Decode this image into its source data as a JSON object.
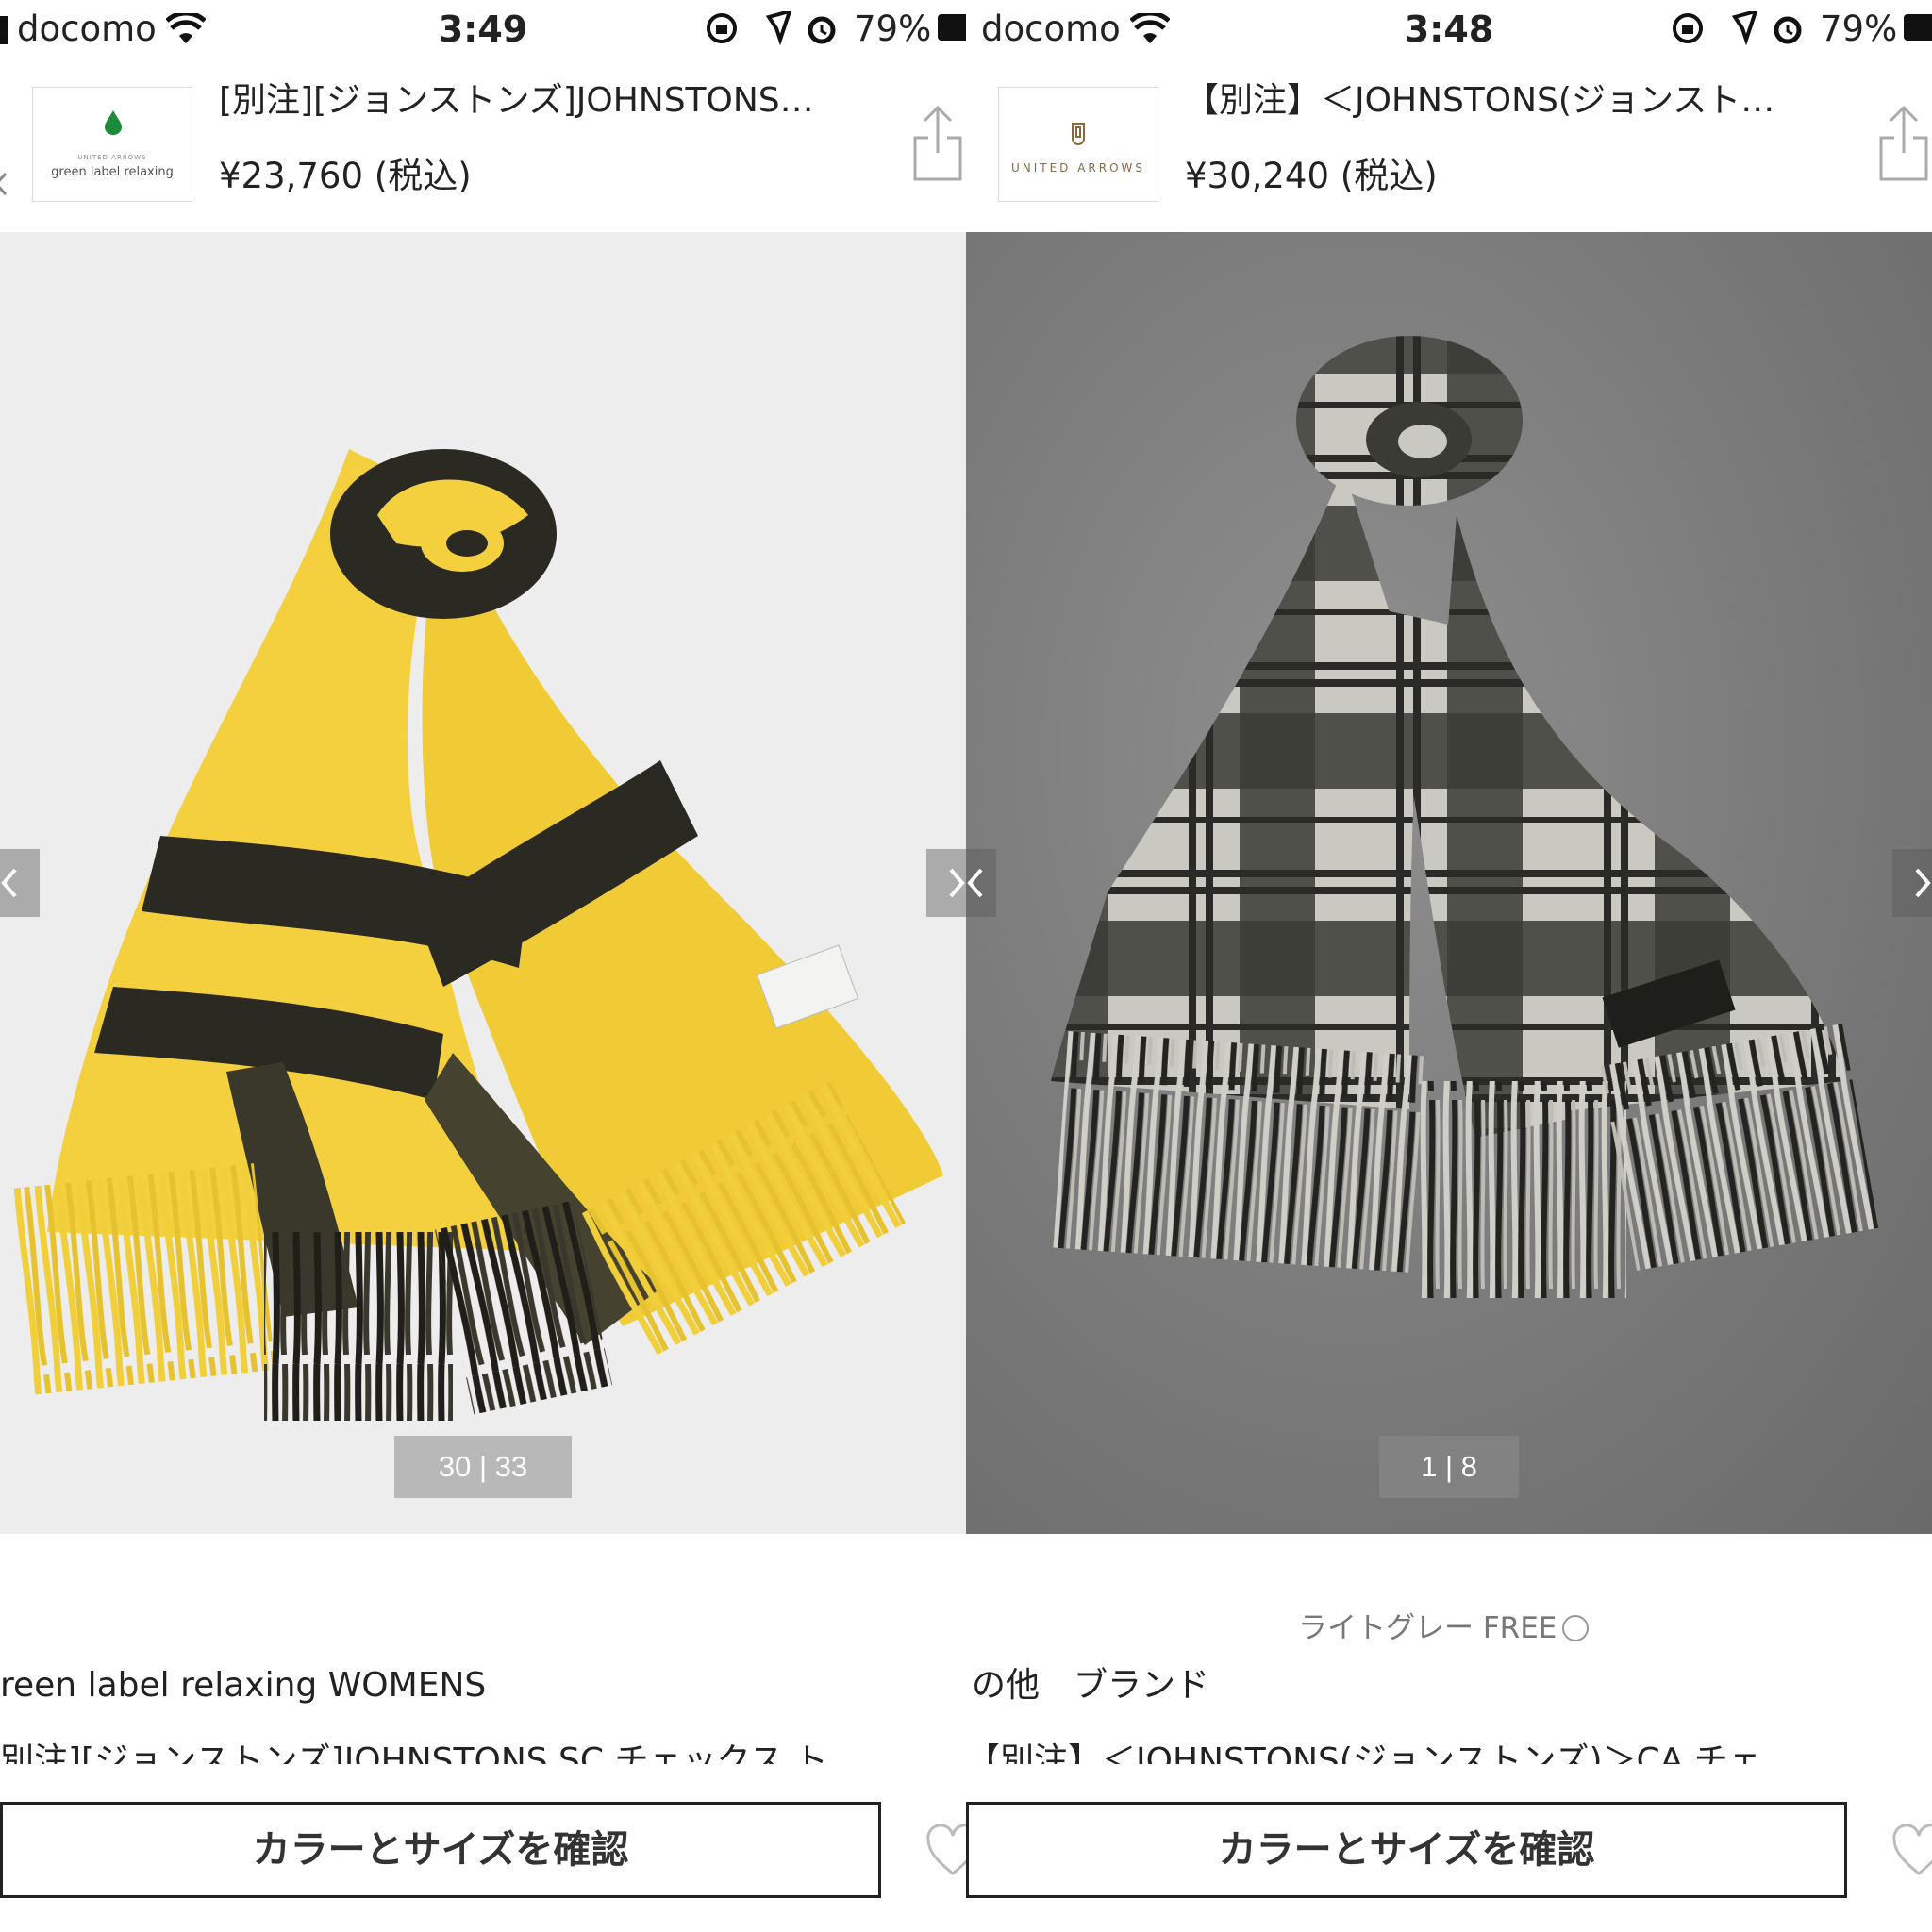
{
  "panels": [
    {
      "status": {
        "carrier": "docomo",
        "time": "3:49",
        "battery": "79%"
      },
      "header": {
        "logo_small": "UNITED ARROWS",
        "logo_text": "green label relaxing",
        "title": "[別注][ジョンストンズ]JOHNSTONS…",
        "price": "¥23,760 (税込)"
      },
      "gallery": {
        "counter": "30 | 33",
        "colors": {
          "background": "#eeedee",
          "scarf_primary": "#f4d03f",
          "scarf_stripe": "#2b2a22"
        }
      },
      "color_size": "",
      "brand": "reen label relaxing WOMENS",
      "description": "別注][ジョンストンズ]JOHNSTONS SC チェックス ト",
      "cta_label": "カラーとサイズを確認"
    },
    {
      "status": {
        "carrier": "docomo",
        "time": "3:48",
        "battery": "79%"
      },
      "header": {
        "logo_text": "UNITED ARROWS",
        "title": "【別注】＜JOHNSTONS(ジョンスト…",
        "price": "¥30,240 (税込)"
      },
      "gallery": {
        "counter": "1 | 8",
        "colors": {
          "background": "#7a7a7a",
          "scarf_primary": "#c9c9c2",
          "scarf_stripe": "#2a2a26"
        }
      },
      "color_size": "ライトグレー FREE",
      "brand": "の他　ブランド",
      "description": "【別注】＜JOHNSTONS(ジョンストンズ)＞CA チェ",
      "cta_label": "カラーとサイズを確認"
    }
  ]
}
